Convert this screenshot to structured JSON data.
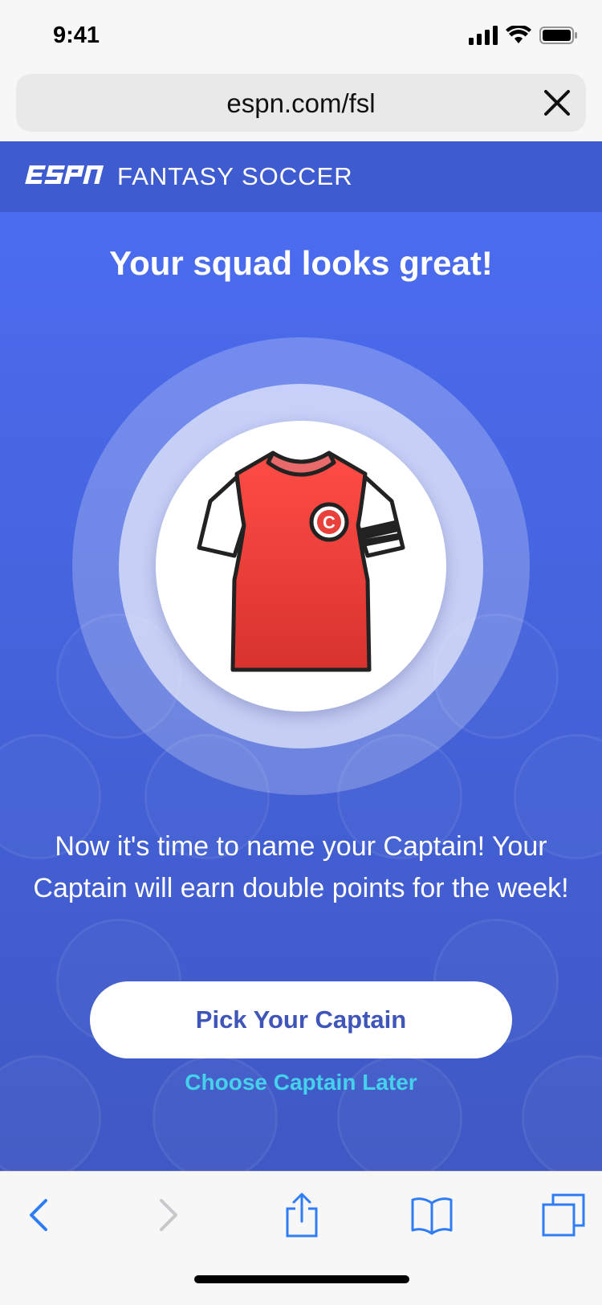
{
  "status_bar": {
    "time": "9:41"
  },
  "browser": {
    "url": "espn.com/fsl"
  },
  "header": {
    "logo_text": "ESPN",
    "title": "FANTASY SOCCER"
  },
  "main": {
    "headline": "Your squad looks great!",
    "jersey_badge": "C",
    "message": "Now it's time to name your Captain! Your Captain will earn double points for the week!",
    "cta_label": "Pick Your Captain",
    "secondary_label": "Choose Captain Later"
  },
  "colors": {
    "header_bg": "#3f5bd0",
    "main_bg": "#4462d9",
    "cta_text": "#3f55b9",
    "link": "#45d1ec",
    "jersey_red": "#e9403c",
    "toolbar_icon": "#2f7df6"
  },
  "toolbar": {
    "icons": [
      "back-icon",
      "forward-icon",
      "share-icon",
      "bookmarks-icon",
      "tabs-icon"
    ]
  }
}
